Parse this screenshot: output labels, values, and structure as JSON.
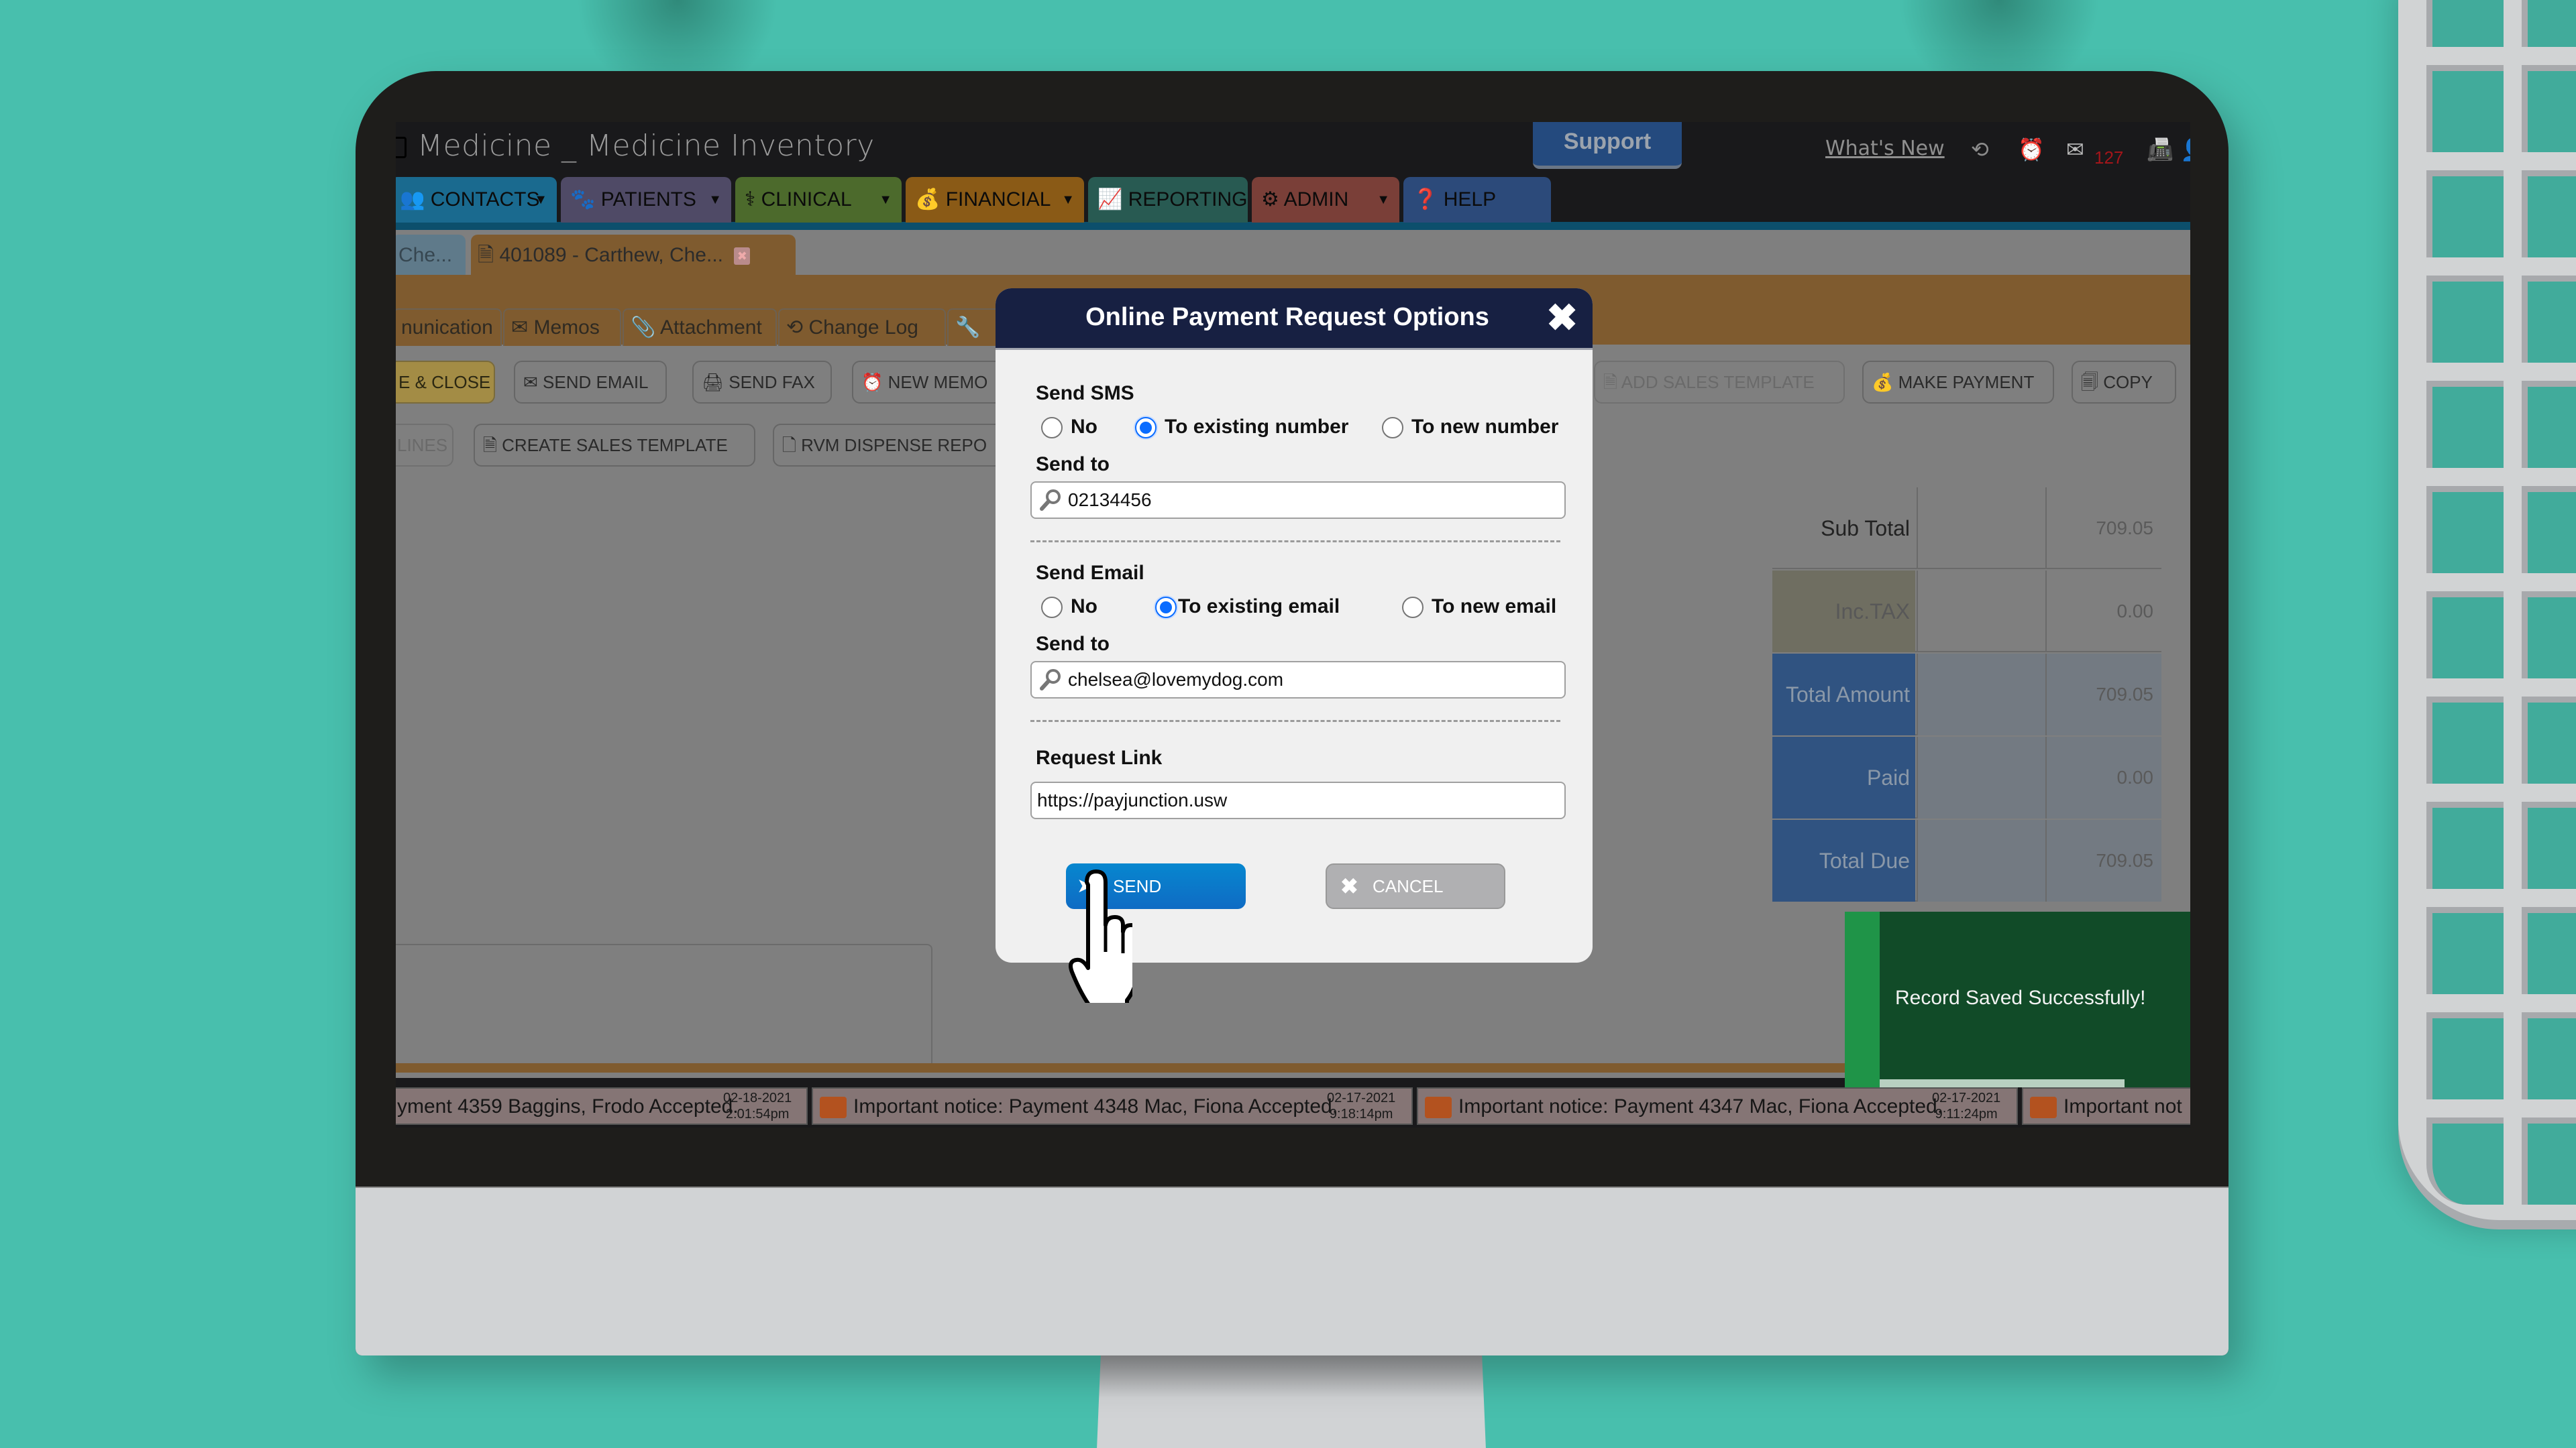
{
  "app": {
    "title": "Medicine _ Medicine Inventory",
    "support_label": "Support",
    "whats_new_label": "What's New",
    "mail_count": "127",
    "header_icons": [
      "history-icon",
      "alarm-icon",
      "mail-icon",
      "fax-icon",
      "user-icon"
    ]
  },
  "nav": {
    "tabs": [
      {
        "label": "CONTACTS",
        "icon": "contacts-icon",
        "color": "#1a6a8f",
        "has_caret": true
      },
      {
        "label": "PATIENTS",
        "icon": "paw-icon",
        "color": "#4f4a66",
        "has_caret": true
      },
      {
        "label": "CLINICAL",
        "icon": "caduceus-icon",
        "color": "#4c6a2c",
        "has_caret": true
      },
      {
        "label": "FINANCIAL",
        "icon": "money-bag-icon",
        "color": "#8a5a16",
        "has_caret": true
      },
      {
        "label": "REPORTING",
        "icon": "chart-icon",
        "color": "#285a52",
        "has_caret": false
      },
      {
        "label": "ADMIN",
        "icon": "gear-icon",
        "color": "#7a3f38",
        "has_caret": true
      },
      {
        "label": "HELP",
        "icon": "help-icon",
        "color": "#2c4a7a",
        "has_caret": false
      }
    ]
  },
  "doc_tabs": [
    {
      "label": "Che...",
      "active": false
    },
    {
      "label": "401089 - Carthew, Che...",
      "active": true
    }
  ],
  "sub_tabs": [
    "nunication",
    "Memos",
    "Attachment",
    "Change Log",
    ""
  ],
  "toolbar_row1": [
    {
      "label": "E & CLOSE",
      "style": "yellow"
    },
    {
      "label": "SEND EMAIL"
    },
    {
      "label": "SEND FAX"
    },
    {
      "label": "NEW MEMO"
    },
    {
      "label": "ADD SALES TEMPLATE",
      "disabled": true
    },
    {
      "label": "MAKE PAYMENT"
    },
    {
      "label": "COPY"
    }
  ],
  "toolbar_row2": [
    {
      "label": "LINES",
      "disabled": true
    },
    {
      "label": "CREATE SALES TEMPLATE"
    },
    {
      "label": "RVM DISPENSE REPO"
    }
  ],
  "totals": [
    {
      "label": "Sub Total",
      "value": "709.05"
    },
    {
      "label": "Inc.TAX",
      "value": "0.00"
    },
    {
      "label": "Total Amount",
      "value": "709.05"
    },
    {
      "label": "Paid",
      "value": "0.00"
    },
    {
      "label": "Total Due",
      "value": "709.05"
    }
  ],
  "toast": {
    "message": "Record Saved Successfully!",
    "progress": 0.78
  },
  "ticker": [
    {
      "text": "yment 4359 Baggins, Frodo Accepted.",
      "date": "02-18-2021",
      "time": "2:01:54pm",
      "icon": false
    },
    {
      "text": "Important notice: Payment 4348 Mac, Fiona Accepted.",
      "date": "02-17-2021",
      "time": "9:18:14pm",
      "icon": true
    },
    {
      "text": "Important notice: Payment 4347 Mac, Fiona Accepted.",
      "date": "02-17-2021",
      "time": "9:11:24pm",
      "icon": true
    },
    {
      "text": "Important not",
      "date": "",
      "time": "",
      "icon": true
    }
  ],
  "dialog": {
    "title": "Online Payment Request Options",
    "sms": {
      "heading": "Send SMS",
      "options": [
        "No",
        "To existing number",
        "To new number"
      ],
      "selected": "To existing number",
      "send_to_label": "Send to",
      "send_to_value": "02134456"
    },
    "email": {
      "heading": "Send Email",
      "options": [
        "No",
        "To existing email",
        "To new email"
      ],
      "selected": "To existing email",
      "send_to_label": "Send to",
      "send_to_value": "chelsea@lovemydog.com"
    },
    "request_link": {
      "label": "Request Link",
      "value": "https://payjunction.usw"
    },
    "send_label": "SEND",
    "cancel_label": "CANCEL"
  }
}
